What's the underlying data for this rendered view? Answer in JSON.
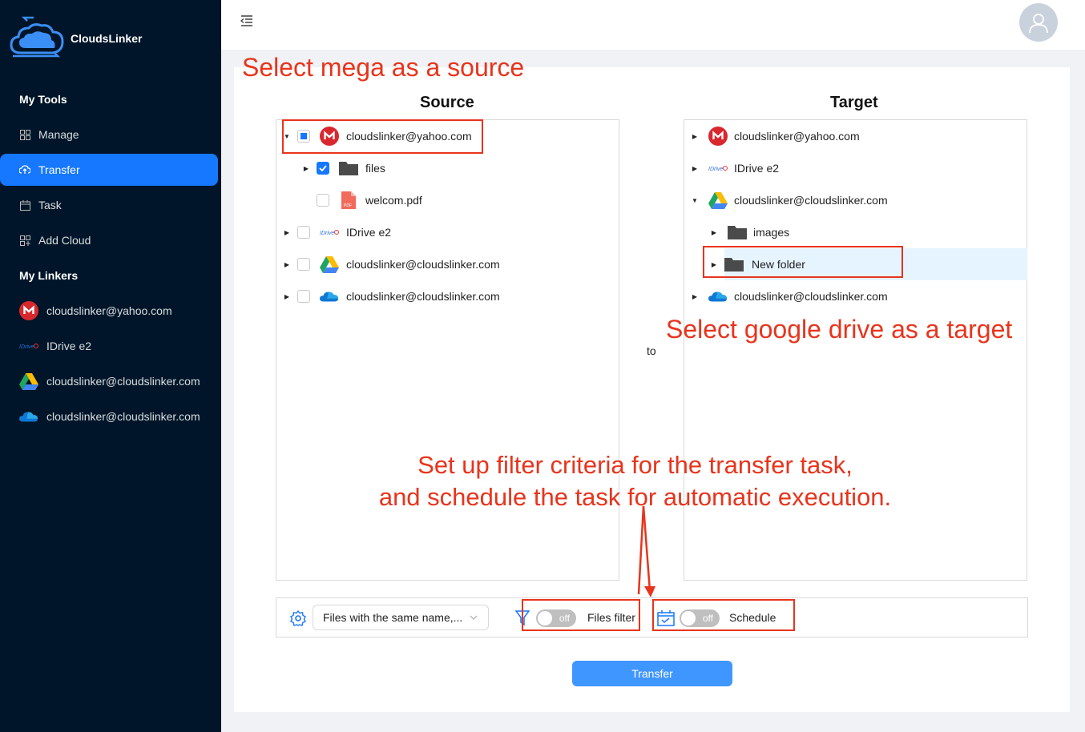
{
  "app": {
    "name": "CloudsLinker"
  },
  "sidebar": {
    "tools_heading": "My Tools",
    "items": [
      {
        "label": "Manage",
        "icon": "grid-icon"
      },
      {
        "label": "Transfer",
        "icon": "cloud-sync-icon",
        "active": true
      },
      {
        "label": "Task",
        "icon": "calendar-icon"
      },
      {
        "label": "Add Cloud",
        "icon": "add-grid-icon"
      }
    ],
    "linkers_heading": "My Linkers",
    "linkers": [
      {
        "label": "cloudslinker@yahoo.com",
        "icon": "mega-icon"
      },
      {
        "label": "IDrive e2",
        "icon": "idrive-icon"
      },
      {
        "label": "cloudslinker@cloudslinker.com",
        "icon": "google-drive-icon"
      },
      {
        "label": "cloudslinker@cloudslinker.com",
        "icon": "onedrive-icon"
      }
    ]
  },
  "header": {
    "menu_icon": "menu-fold-icon",
    "avatar_icon": "user-icon"
  },
  "source": {
    "title": "Source",
    "rows": [
      {
        "label": "cloudslinker@yahoo.com",
        "icon": "mega-icon",
        "expanded": true,
        "check": "partial"
      },
      {
        "label": "files",
        "icon": "folder-icon",
        "expanded": false,
        "check": "checked"
      },
      {
        "label": "welcom.pdf",
        "icon": "pdf-icon",
        "check": "unchecked"
      },
      {
        "label": "IDrive e2",
        "icon": "idrive-icon",
        "expanded": false,
        "check": "unchecked"
      },
      {
        "label": "cloudslinker@cloudslinker.com",
        "icon": "google-drive-icon",
        "expanded": false,
        "check": "unchecked"
      },
      {
        "label": "cloudslinker@cloudslinker.com",
        "icon": "onedrive-icon",
        "expanded": false,
        "check": "unchecked"
      }
    ]
  },
  "connector": {
    "label": "to"
  },
  "target": {
    "title": "Target",
    "rows": [
      {
        "label": "cloudslinker@yahoo.com",
        "icon": "mega-icon",
        "expanded": false
      },
      {
        "label": "IDrive e2",
        "icon": "idrive-icon",
        "expanded": false
      },
      {
        "label": "cloudslinker@cloudslinker.com",
        "icon": "google-drive-icon",
        "expanded": true
      },
      {
        "label": "images",
        "icon": "folder-icon",
        "expanded": false
      },
      {
        "label": "New folder",
        "icon": "folder-icon",
        "expanded": false,
        "selected": true
      },
      {
        "label": "cloudslinker@cloudslinker.com",
        "icon": "onedrive-icon",
        "expanded": false
      }
    ]
  },
  "options": {
    "conflict_select": "Files with the same name,...",
    "files_filter": {
      "label": "Files filter",
      "state": "off"
    },
    "schedule": {
      "label": "Schedule",
      "state": "off"
    }
  },
  "transfer_button": "Transfer",
  "annotations": {
    "source": "Select mega as a source",
    "target": "Select google drive as a target",
    "filter_line1": "Set up filter criteria for the transfer task,",
    "filter_line2": "and schedule the task for automatic execution."
  },
  "colors": {
    "sidebar_bg": "#001529",
    "accent": "#1677ff",
    "annotation": "#e8341c",
    "mega": "#d9272e"
  }
}
